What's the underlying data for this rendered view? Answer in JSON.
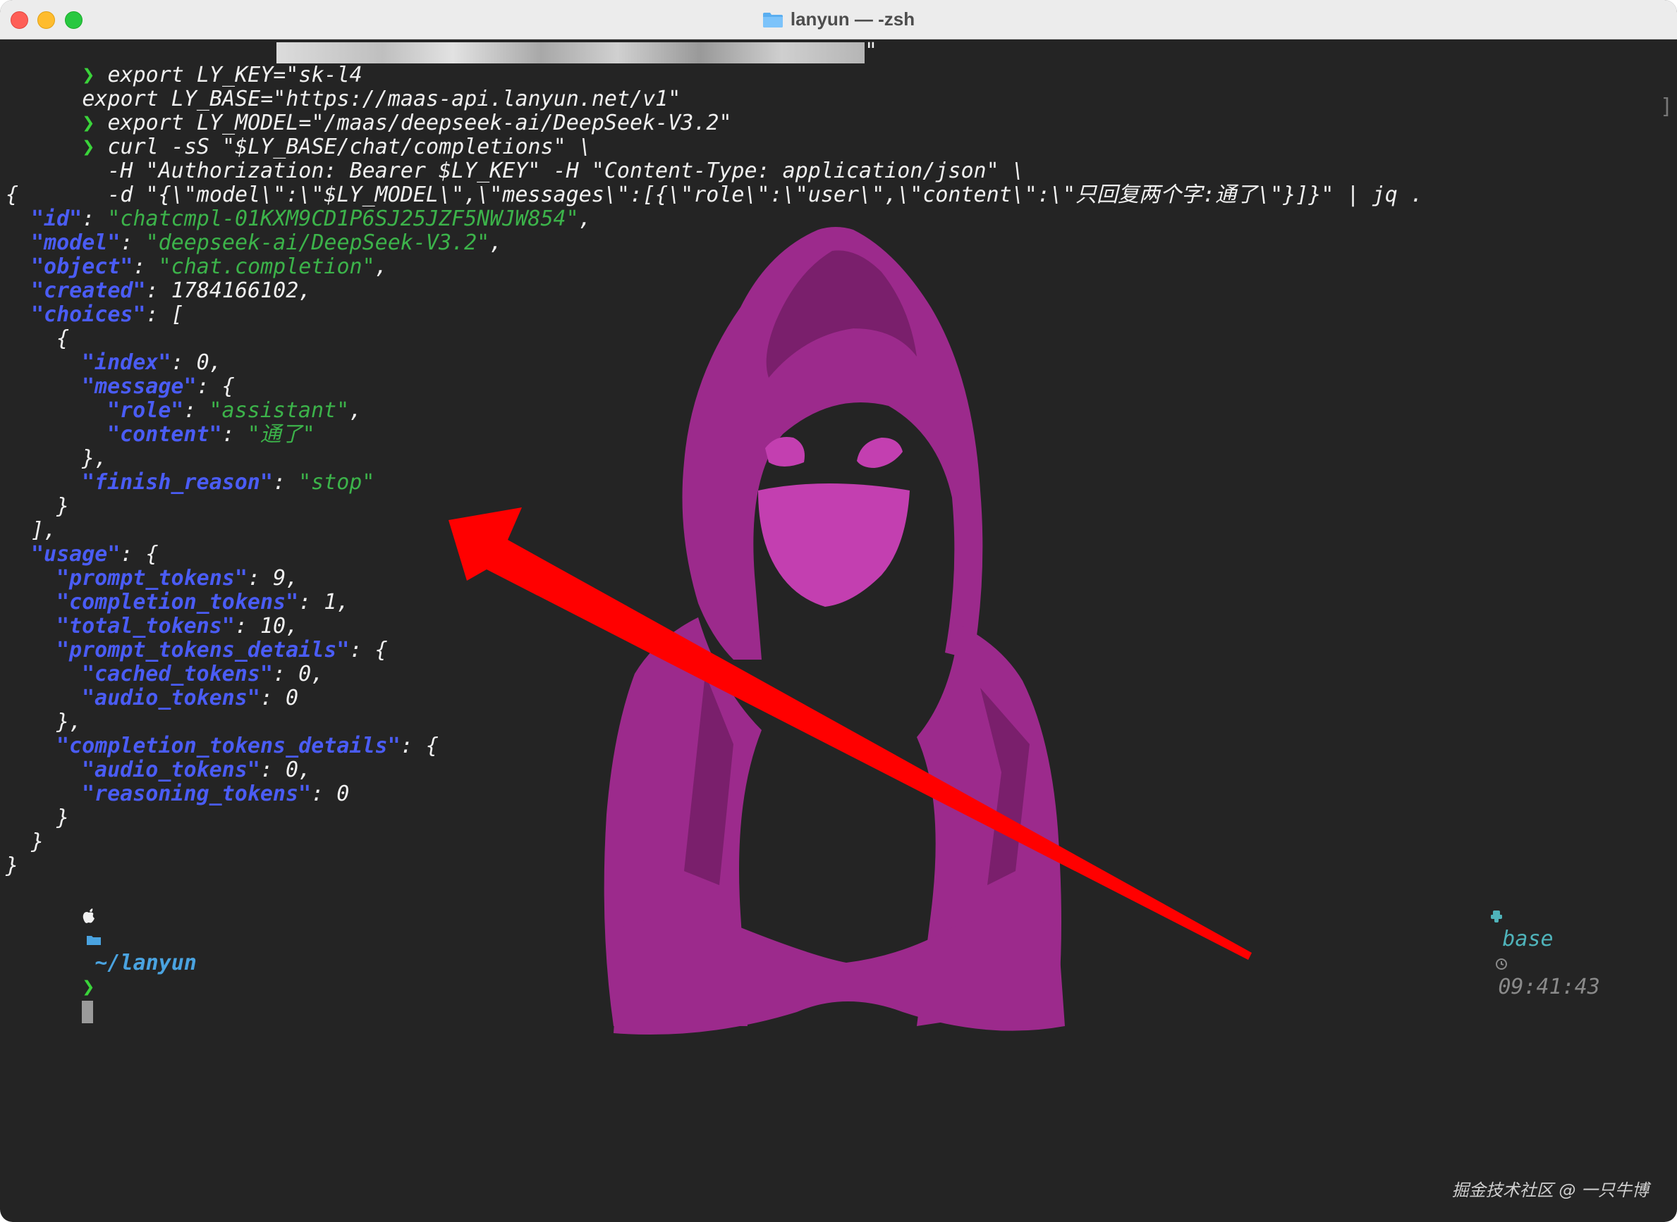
{
  "window": {
    "title": "lanyun — -zsh"
  },
  "colors": {
    "background": "#242424",
    "json_key": "#4a5cf5",
    "json_string": "#3cb34a",
    "prompt": "#3ad33a",
    "hoodie": "#9c2a8c",
    "arrow": "#ff0000"
  },
  "terminal": {
    "prompt_char": "❯",
    "lines": [
      "export LY_KEY=\"sk-l4",
      "export LY_BASE=\"https://maas-api.lanyun.net/v1\"",
      "export LY_MODEL=\"/maas/deepseek-ai/DeepSeek-V3.2\"",
      "curl -sS \"$LY_BASE/chat/completions\" \\",
      "-H \"Authorization: Bearer $LY_KEY\" -H \"Content-Type: application/json\" \\",
      "-d \"{\\\"model\\\":\\\"$LY_MODEL\\\",\\\"messages\\\":[{\\\"role\\\":\\\"user\\\",\\\"content\\\":\\\"只回复两个字:通了\\\"}]}\" | jq ."
    ],
    "json": {
      "open": "{",
      "id_key": "\"id\"",
      "id_val": "\"chatcmpl-01KXM9CD1P6SJ25JZF5NWJW854\"",
      "model_key": "\"model\"",
      "model_val": "\"deepseek-ai/DeepSeek-V3.2\"",
      "object_key": "\"object\"",
      "object_val": "\"chat.completion\"",
      "created_key": "\"created\"",
      "created_val": "1784166102",
      "choices_key": "\"choices\"",
      "index_key": "\"index\"",
      "index_val": "0",
      "message_key": "\"message\"",
      "role_key": "\"role\"",
      "role_val": "\"assistant\"",
      "content_key": "\"content\"",
      "content_val": "\"通了\"",
      "finish_key": "\"finish_reason\"",
      "finish_val": "\"stop\"",
      "usage_key": "\"usage\"",
      "prompt_tokens_key": "\"prompt_tokens\"",
      "prompt_tokens_val": "9",
      "completion_tokens_key": "\"completion_tokens\"",
      "completion_tokens_val": "1",
      "total_tokens_key": "\"total_tokens\"",
      "total_tokens_val": "10",
      "prompt_details_key": "\"prompt_tokens_details\"",
      "cached_tokens_key": "\"cached_tokens\"",
      "cached_tokens_val": "0",
      "audio_tokens_key": "\"audio_tokens\"",
      "audio_tokens_val": "0",
      "completion_details_key": "\"completion_tokens_details\"",
      "reasoning_tokens_key": "\"reasoning_tokens\"",
      "reasoning_tokens_val": "0"
    },
    "status": {
      "path": "~/lanyun",
      "env": "base",
      "time": "09:41:43"
    }
  },
  "watermark": "掘金技术社区 @ 一只牛博"
}
